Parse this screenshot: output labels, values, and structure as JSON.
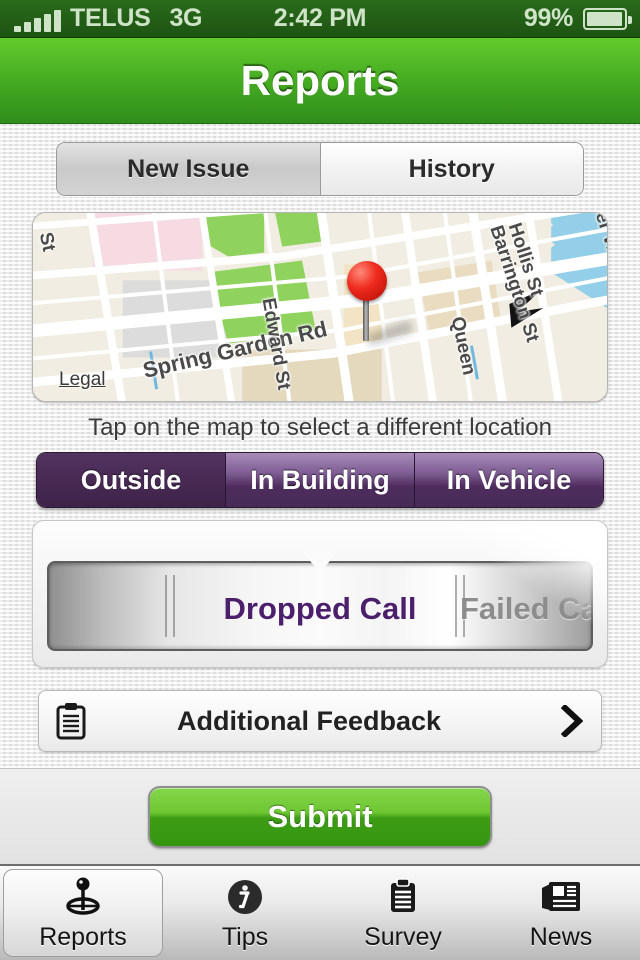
{
  "status_bar": {
    "signal_bars": 5,
    "carrier": "TELUS",
    "network": "3G",
    "time": "2:42 PM",
    "battery_percent": "99%"
  },
  "nav": {
    "title": "Reports"
  },
  "top_tabs": {
    "items": [
      {
        "label": "New Issue",
        "selected": true
      },
      {
        "label": "History",
        "selected": false
      }
    ]
  },
  "map": {
    "pin_label": "map-pin",
    "legal_link": "Legal",
    "street_labels": [
      "Spring Garden Rd",
      "Hollis St",
      "Barrington St",
      "Lower Water St",
      "Queen",
      "Edward St",
      "St"
    ]
  },
  "hint": "Tap on the map to select a different location",
  "location_segments": {
    "items": [
      {
        "label": "Outside",
        "selected": true
      },
      {
        "label": "In Building",
        "selected": false
      },
      {
        "label": "In Vehicle",
        "selected": false
      }
    ]
  },
  "issue_picker": {
    "selected": "Dropped Call",
    "next_partial": "Failed Call"
  },
  "feedback_row": {
    "label": "Additional Feedback"
  },
  "submit": {
    "label": "Submit"
  },
  "tab_bar": {
    "items": [
      {
        "label": "Reports",
        "icon": "map-pin-icon",
        "active": true
      },
      {
        "label": "Tips",
        "icon": "info-circle-icon",
        "active": false
      },
      {
        "label": "Survey",
        "icon": "clipboard-icon",
        "active": false
      },
      {
        "label": "News",
        "icon": "newspaper-icon",
        "active": false
      }
    ]
  },
  "colors": {
    "nav_green_light": "#63cb2c",
    "nav_green_dark": "#2f8d1b",
    "status_green": "#1d5412",
    "purple_selected": "#472952",
    "purple_gloss": "#a98cba",
    "submit_green": "#6ec733",
    "picker_text_purple": "#4b1f6b"
  }
}
